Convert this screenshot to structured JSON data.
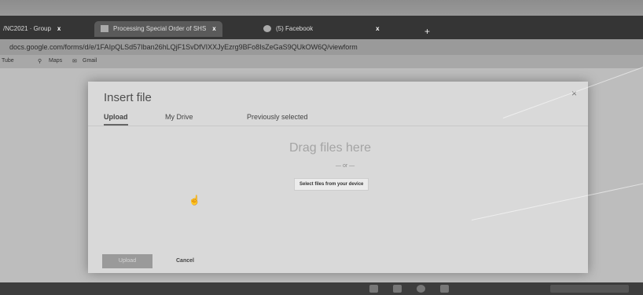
{
  "browser": {
    "tabs": [
      {
        "label": "/NC2021 · Group"
      },
      {
        "label": "Processing Special Order of SHS"
      },
      {
        "label": "(5) Facebook"
      }
    ],
    "new_tab_glyph": "+",
    "tab_close_glyph": "x",
    "url": "docs.google.com/forms/d/e/1FAIpQLSd57Iban26hLQjF1SvDfVIXXJyEzrg9BFo8IsZeGaS9QUkOW6Q/viewform",
    "bookmarks": [
      {
        "label": "Tube"
      },
      {
        "label": "Maps"
      },
      {
        "label": "Gmail"
      }
    ]
  },
  "dialog": {
    "title": "Insert file",
    "close_glyph": "×",
    "tabs": [
      {
        "label": "Upload",
        "active": true
      },
      {
        "label": "My Drive",
        "active": false
      },
      {
        "label": "Previously selected",
        "active": false
      }
    ],
    "drag_text": "Drag files here",
    "or_text": "— or —",
    "select_button": "Select files from your device",
    "upload_button": "Upload",
    "cancel_button": "Cancel"
  },
  "icons": {
    "cursor": "hand-cursor-icon",
    "maps": "map-pin-icon",
    "gmail": "mail-icon"
  }
}
